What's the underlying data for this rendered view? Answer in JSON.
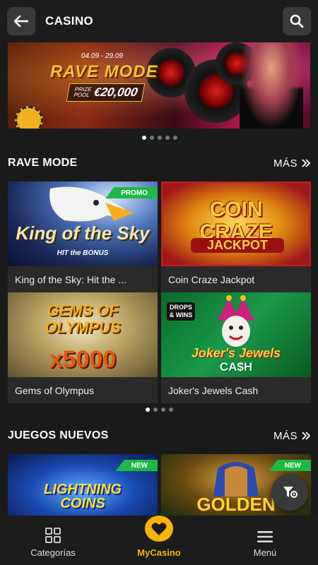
{
  "header": {
    "title": "CASINO",
    "back_icon": "arrow-left-icon",
    "search_icon": "search-icon"
  },
  "banner": {
    "date_range": "04.09 - 29.09",
    "title": "RAVE MODE",
    "prize_label": "PRIZE POOL",
    "prize_amount": "€20,000"
  },
  "banner_carousel": {
    "dot_count": 5,
    "active_index": 0
  },
  "sections": [
    {
      "title": "RAVE MODE",
      "more_label": "MÁS",
      "games": [
        {
          "name": "King of the Sky: Hit the ...",
          "badge": "PROMO",
          "art_title": "King of the Sky",
          "art_sub": "HIT the BONUS"
        },
        {
          "name": "Coin Craze Jackpot",
          "badge": "",
          "art_title": "COIN CRAZE",
          "art_sub": "JACKPOT"
        },
        {
          "name": "Gems of Olympus",
          "badge": "",
          "art_title": "GEMS OF OLYMPUS",
          "art_sub": "x5000"
        },
        {
          "name": "Joker's Jewels Cash",
          "badge": "",
          "art_title": "Joker's Jewels",
          "art_sub": "CA$H",
          "corner_tag": "DROPS & WINS"
        }
      ],
      "carousel": {
        "dot_count": 4,
        "active_index": 0
      }
    },
    {
      "title": "JUEGOS NUEVOS",
      "more_label": "MÁS",
      "games": [
        {
          "name": "",
          "badge": "NEW",
          "art_title": "LIGHTNING COINS"
        },
        {
          "name": "",
          "badge": "NEW",
          "art_title": "GOLDEN"
        }
      ]
    }
  ],
  "fab": {
    "icon": "filter-icon"
  },
  "bottom_nav": [
    {
      "label": "Categorías",
      "icon": "grid-icon"
    },
    {
      "label": "MyCasino",
      "icon": "heart-icon"
    },
    {
      "label": "Menú",
      "icon": "hamburger-menu-icon"
    }
  ],
  "colors": {
    "accent": "#f8b400",
    "badge_green": "#1db944",
    "background": "#1a1a1a",
    "card": "#2a2a2a"
  }
}
